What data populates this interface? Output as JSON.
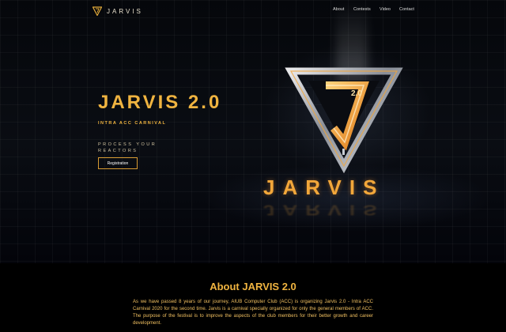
{
  "nav": {
    "brand": "JARVIS",
    "menu": [
      "About",
      "Contests",
      "Video",
      "Contact"
    ]
  },
  "hero": {
    "title": "JARVIS 2.0",
    "subtitle": "INTRA ACC CARNIVAL",
    "tagline": "PROCESS YOUR REACTORS",
    "register_label": "Registration",
    "emblem_badge": "2.0",
    "emblem_wordmark": "JARVIS"
  },
  "about": {
    "title": "About JARVIS 2.0",
    "text": "As we have passed 8 years of our journey, AIUB Computer Club (ACC) is organizing Jarvis 2.0 - Intra ACC Carnival 2020 for the second time. Jarvis is a carnival specially organized for only the general members of ACC. The purpose of the festival is to improve the aspects of the club members for their better growth and career development."
  },
  "colors": {
    "accent": "#f0b440",
    "background": "#000000"
  }
}
